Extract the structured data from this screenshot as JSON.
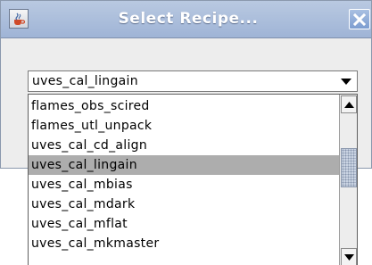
{
  "window": {
    "title": "Select Recipe...",
    "app_icon": "java-cup-icon",
    "close_icon": "close-icon"
  },
  "combo": {
    "selected_value": "uves_cal_lingain",
    "arrow_icon": "chevron-down-icon"
  },
  "dropdown": {
    "items": [
      "flames_obs_scired",
      "flames_utl_unpack",
      "uves_cal_cd_align",
      "uves_cal_lingain",
      "uves_cal_mbias",
      "uves_cal_mdark",
      "uves_cal_mflat",
      "uves_cal_mkmaster"
    ],
    "highlighted_item": "uves_cal_lingain",
    "scroll_up_icon": "arrow-up-icon",
    "scroll_down_icon": "arrow-down-icon"
  },
  "colors": {
    "titlebar": "#b0c2de",
    "selection": "#adadad",
    "dialog_bg": "#ededed"
  }
}
